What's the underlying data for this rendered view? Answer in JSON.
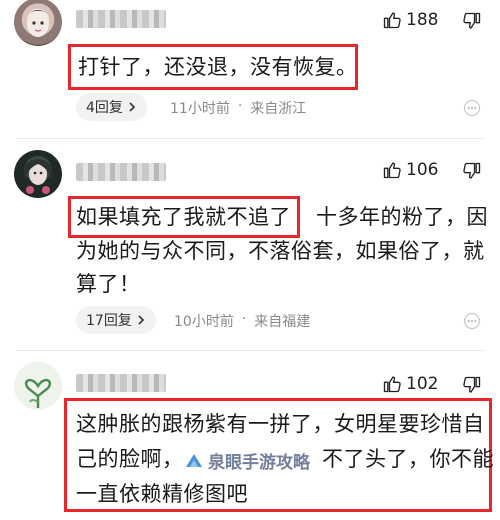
{
  "comments": [
    {
      "likes": "188",
      "text": "打针了，还没退，没有恢复。",
      "reply_label": "4回复",
      "time": "11小时前",
      "location": "来自浙江"
    },
    {
      "likes": "106",
      "text_highlight": "如果填充了我就不追了",
      "text_line1_rest": "十多年的粉了，因",
      "text_line2": "为她的与众不同，不落俗套，如果俗了，就",
      "text_line3": "算了！",
      "reply_label": "17回复",
      "time": "10小时前",
      "location": "来自福建"
    },
    {
      "likes": "102",
      "text_line1": "这肿胀的跟杨紫有一拼了，女明星要珍惜自",
      "text_line2_a": "己的脸啊，",
      "text_line2_b": "不了头了，你不能",
      "text_line3": "一直依赖精修图吧"
    }
  ],
  "watermark": {
    "text": "泉眼手游攻略",
    "icon": "watermark-logo-icon"
  },
  "colors": {
    "highlight_border": "#e8262c",
    "meta_text": "#8a8a8a",
    "pill_bg": "#f2f2f2"
  },
  "icons": {
    "like": "thumbs-up-icon",
    "dislike": "thumbs-down-icon",
    "more": "more-icon",
    "chevron": "chevron-right-icon"
  }
}
